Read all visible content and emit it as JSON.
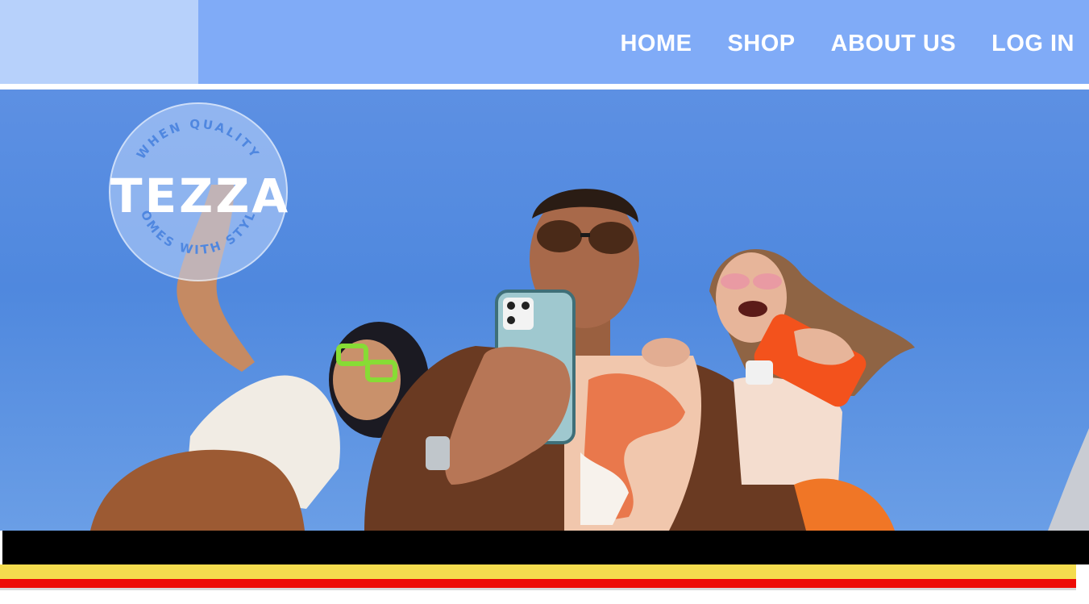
{
  "brand": {
    "name": "TEZZA",
    "tagline_top": "WHEN QUALITY",
    "tagline_bottom": "COMES WITH STYLE"
  },
  "nav": {
    "items": [
      {
        "label": "HOME"
      },
      {
        "label": "SHOP"
      },
      {
        "label": "ABOUT US"
      },
      {
        "label": "LOG IN"
      }
    ]
  },
  "hero": {
    "image": "three-friends-with-phones-photo"
  },
  "colors": {
    "header_bg": "#80abf7",
    "header_light_panel": "#b7d1fb",
    "sky": "#5d90e3",
    "band_black": "#000000",
    "band_yellow": "#f4dc4e",
    "band_red": "#ee0c06"
  }
}
